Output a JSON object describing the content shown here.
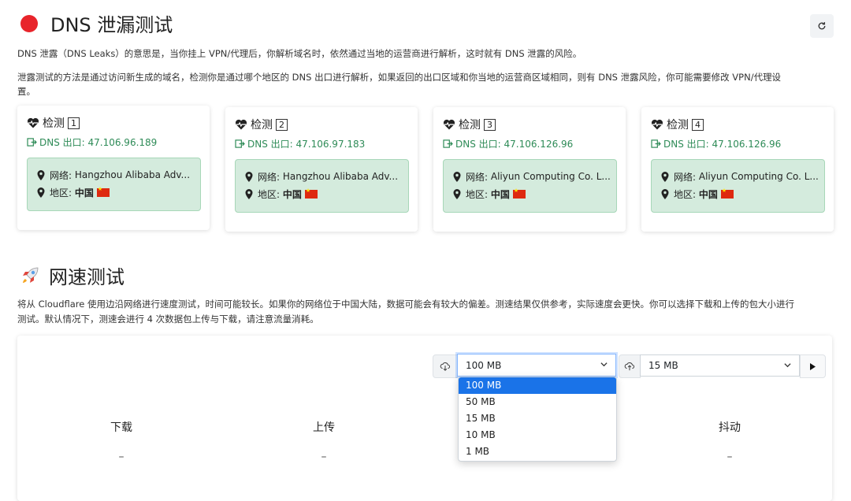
{
  "dns_section": {
    "title": "DNS 泄漏测试",
    "desc1": "DNS 泄露（DNS Leaks）的意思是，当你挂上 VPN/代理后，你解析域名时，依然通过当地的运营商进行解析，这时就有 DNS 泄露的风险。",
    "desc2_line1": "泄露测试的方法是通过访问新生成的域名，检测你是通过哪个地区的 DNS 出口进行解析，如果返回的出口区域和你当地的运营商区域相同，则有 DNS 泄露风险，你可能需要修改 VPN/代理设",
    "desc2_line2": "置。",
    "refresh_icon": "refresh-icon",
    "cards": [
      {
        "label": "检测",
        "num": "1",
        "exit": "DNS 出口: 47.106.96.189",
        "network_label": "网络:",
        "network": "Hangzhou Alibaba Adv...",
        "region_label": "地区:",
        "region": "中国"
      },
      {
        "label": "检测",
        "num": "2",
        "exit": "DNS 出口: 47.106.97.183",
        "network_label": "网络:",
        "network": "Hangzhou Alibaba Adv...",
        "region_label": "地区:",
        "region": "中国"
      },
      {
        "label": "检测",
        "num": "3",
        "exit": "DNS 出口: 47.106.126.96",
        "network_label": "网络:",
        "network": "Aliyun Computing Co. L...",
        "region_label": "地区:",
        "region": "中国"
      },
      {
        "label": "检测",
        "num": "4",
        "exit": "DNS 出口: 47.106.126.96",
        "network_label": "网络:",
        "network": "Aliyun Computing Co. L...",
        "region_label": "地区:",
        "region": "中国"
      }
    ]
  },
  "speed_section": {
    "title": "网速测试",
    "desc_line1": "将从 Cloudflare 使用边沿网络进行速度测试，时间可能较长。如果你的网络位于中国大陆，数据可能会有较大的偏差。测速结果仅供参考，实际速度会更快。你可以选择下载和上传的包大小进行",
    "desc_line2": "测试。默认情况下，测速会进行 4 次数据包上传与下载，请注意流量消耗。",
    "download_select": "100 MB",
    "upload_select": "15 MB",
    "dropdown_options": [
      "100 MB",
      "50 MB",
      "15 MB",
      "10 MB",
      "1 MB"
    ],
    "metrics": [
      {
        "label": "下载",
        "value": "–"
      },
      {
        "label": "上传",
        "value": "–"
      },
      {
        "label": "抖动",
        "value": "–"
      }
    ]
  },
  "colors": {
    "accent": "#2e8b57",
    "info_bg": "#d4ebdd",
    "dns_dot": "#e8242b",
    "selected": "#1a73e8"
  }
}
